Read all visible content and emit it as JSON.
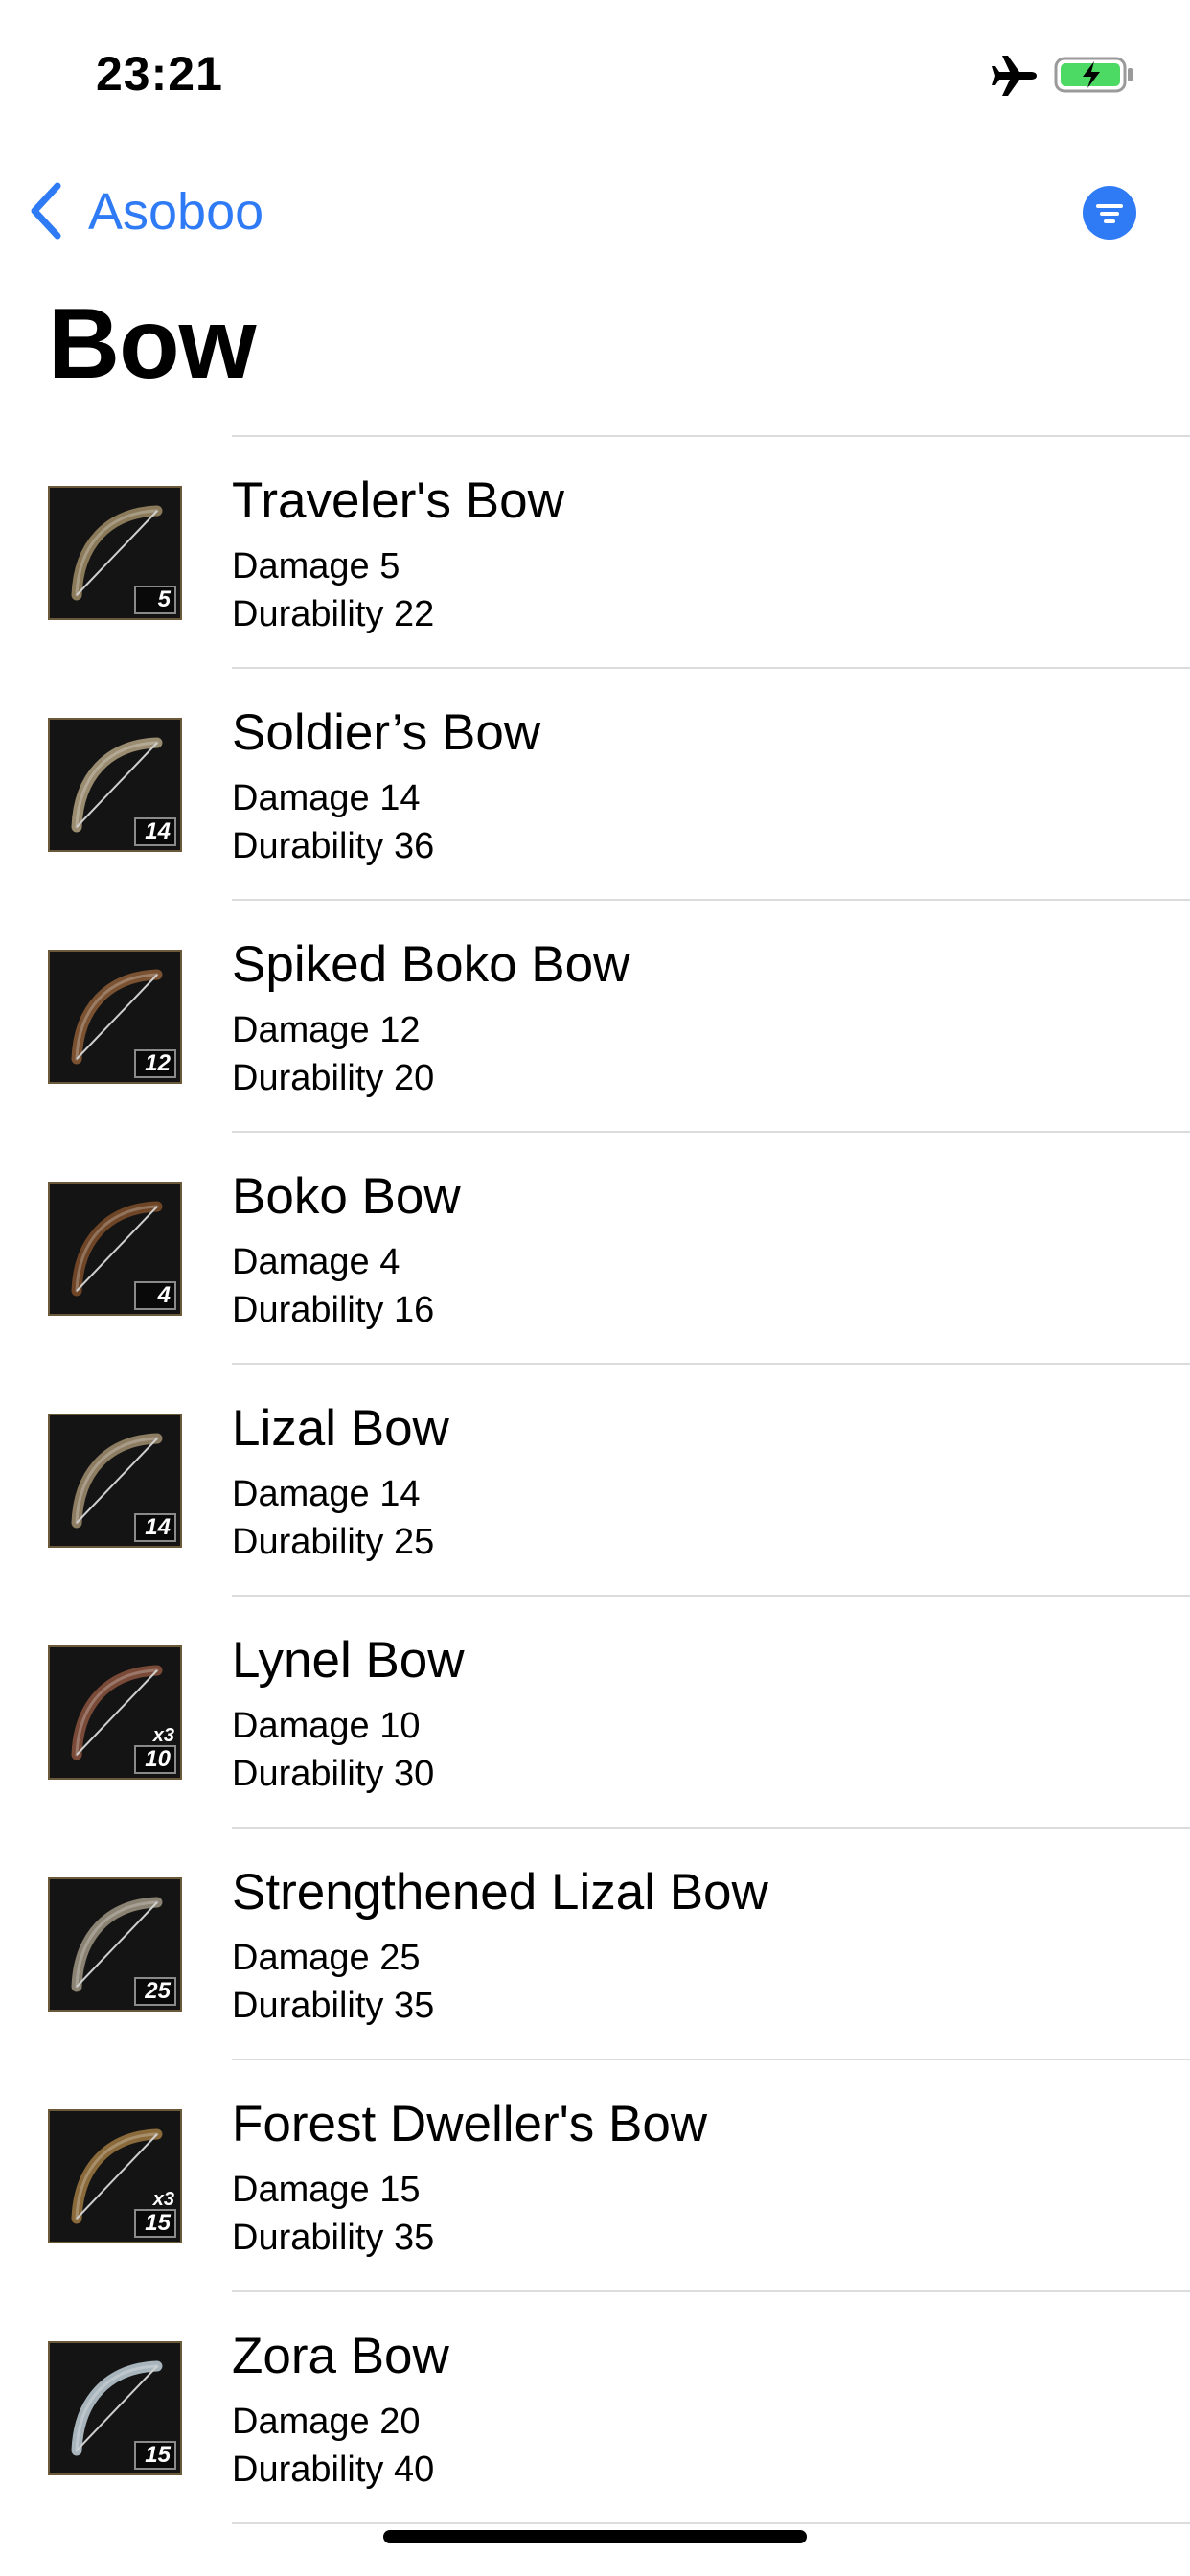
{
  "status_bar": {
    "time": "23:21",
    "airplane_icon": "airplane-icon",
    "battery_icon": "battery-charging-icon",
    "battery_color": "#4cd964"
  },
  "nav": {
    "back_label": "Asoboo",
    "back_icon": "chevron-left-icon",
    "filter_icon": "filter-icon",
    "accent_color": "#2f7bf5"
  },
  "page": {
    "title": "Bow"
  },
  "labels": {
    "damage": "Damage",
    "durability": "Durability"
  },
  "items": [
    {
      "name": "Traveler's Bow",
      "damage": "Damage 5",
      "durability": "Durability 22",
      "badge": "5",
      "multiplier": "",
      "icon": "travelers-bow-icon"
    },
    {
      "name": "Soldier’s Bow",
      "damage": "Damage 14",
      "durability": "Durability 36",
      "badge": "14",
      "multiplier": "",
      "icon": "soldiers-bow-icon"
    },
    {
      "name": "Spiked Boko Bow",
      "damage": "Damage 12",
      "durability": "Durability 20",
      "badge": "12",
      "multiplier": "",
      "icon": "spiked-boko-bow-icon"
    },
    {
      "name": "Boko Bow",
      "damage": "Damage 4",
      "durability": "Durability 16",
      "badge": "4",
      "multiplier": "",
      "icon": "boko-bow-icon"
    },
    {
      "name": "Lizal Bow",
      "damage": "Damage 14",
      "durability": "Durability 25",
      "badge": "14",
      "multiplier": "",
      "icon": "lizal-bow-icon"
    },
    {
      "name": "Lynel Bow",
      "damage": "Damage 10",
      "durability": "Durability 30",
      "badge": "10",
      "multiplier": "x3",
      "icon": "lynel-bow-icon"
    },
    {
      "name": "Strengthened Lizal Bow",
      "damage": "Damage 25",
      "durability": "Durability 35",
      "badge": "25",
      "multiplier": "",
      "icon": "strengthened-lizal-bow-icon"
    },
    {
      "name": "Forest Dweller's Bow",
      "damage": "Damage 15",
      "durability": "Durability 35",
      "badge": "15",
      "multiplier": "x3",
      "icon": "forest-dwellers-bow-icon"
    },
    {
      "name": "Zora Bow",
      "damage": "Damage 20",
      "durability": "Durability 40",
      "badge": "15",
      "multiplier": "",
      "icon": "zora-bow-icon"
    }
  ]
}
